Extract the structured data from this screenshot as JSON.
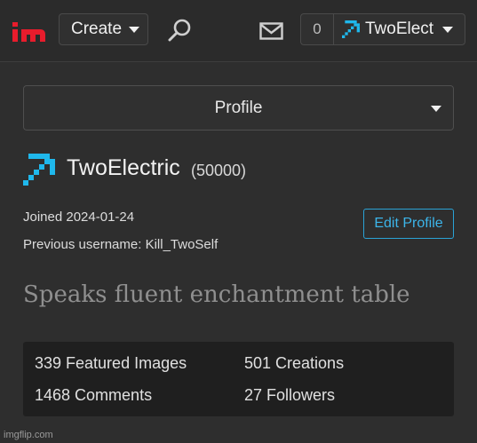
{
  "header": {
    "logo_text": "im",
    "create_label": "Create",
    "notification_count": "0",
    "username_short": "TwoElect"
  },
  "profile_select": {
    "selected": "Profile"
  },
  "user": {
    "name": "TwoElectric",
    "points": "(50000)",
    "joined": "Joined 2024-01-24",
    "previous_username": "Previous username: Kill_TwoSelf",
    "edit_label": "Edit Profile",
    "bio": "Speaks fluent enchantment table"
  },
  "stats": {
    "featured": "339 Featured Images",
    "creations": "501 Creations",
    "comments": "1468 Comments",
    "followers": "27 Followers"
  },
  "watermark": "imgflip.com",
  "colors": {
    "accent": "#2aa3d6",
    "logo_red": "#e81c2c",
    "pickaxe_cyan": "#1fb8ec"
  }
}
